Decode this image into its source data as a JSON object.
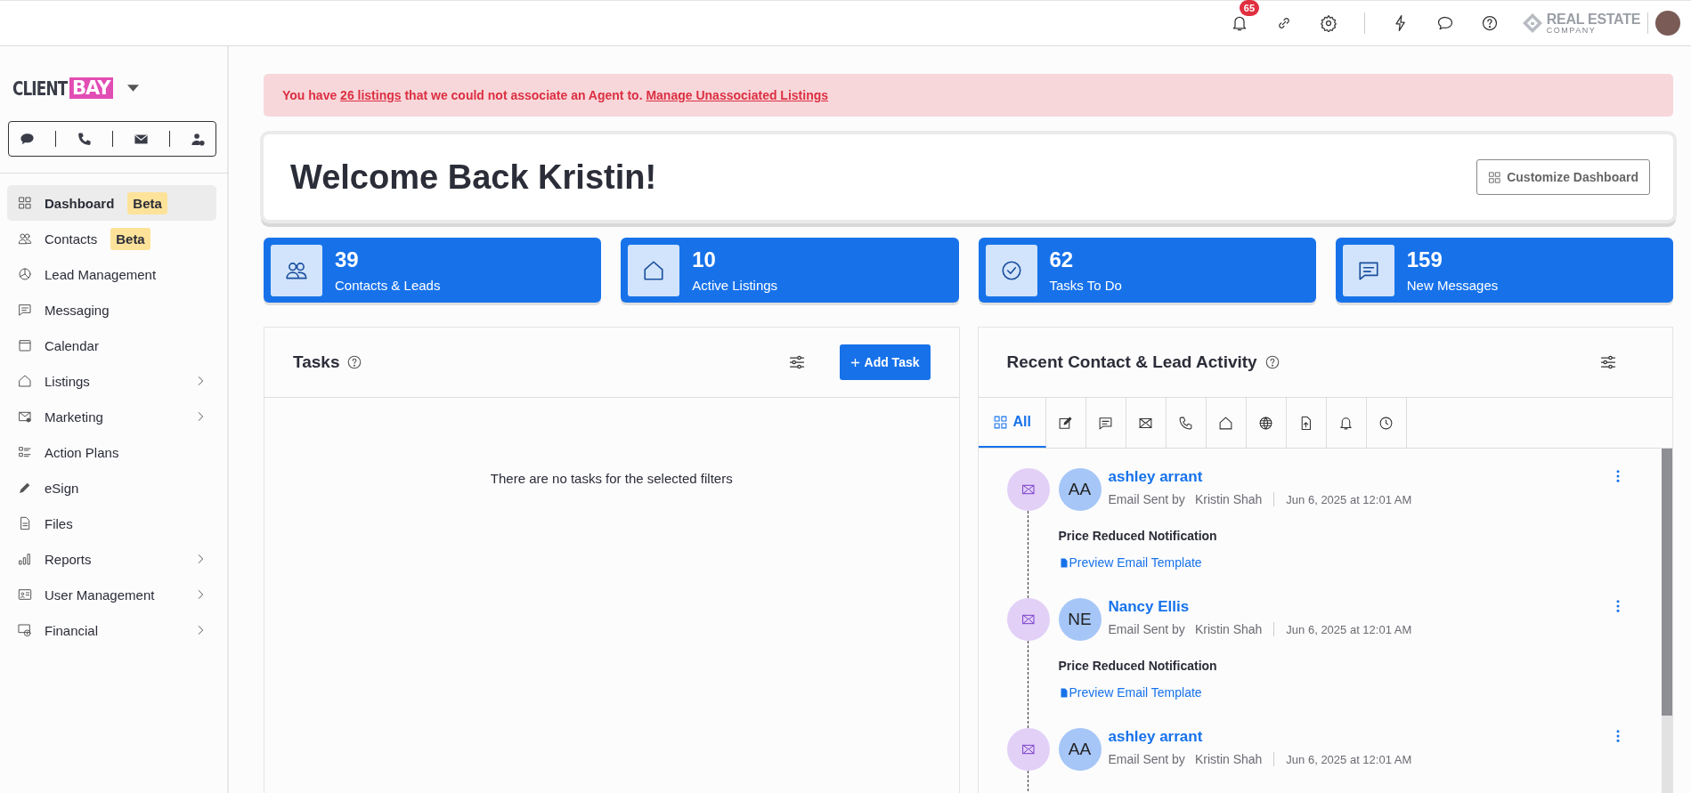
{
  "top_bar": {
    "notification_count": "65",
    "company_logo": {
      "name": "REAL ESTATE",
      "tagline": "COMPANY"
    }
  },
  "sidebar": {
    "brand": {
      "first": "CLIENT",
      "second": "BAY"
    },
    "items": [
      {
        "label": "Dashboard",
        "badge": "Beta",
        "selected": true,
        "expandable": false
      },
      {
        "label": "Contacts",
        "badge": "Beta",
        "selected": false,
        "expandable": false
      },
      {
        "label": "Lead Management",
        "selected": false,
        "expandable": false
      },
      {
        "label": "Messaging",
        "selected": false,
        "expandable": false
      },
      {
        "label": "Calendar",
        "selected": false,
        "expandable": false
      },
      {
        "label": "Listings",
        "selected": false,
        "expandable": true
      },
      {
        "label": "Marketing",
        "selected": false,
        "expandable": true
      },
      {
        "label": "Action Plans",
        "selected": false,
        "expandable": false
      },
      {
        "label": "eSign",
        "selected": false,
        "expandable": false
      },
      {
        "label": "Files",
        "selected": false,
        "expandable": false
      },
      {
        "label": "Reports",
        "selected": false,
        "expandable": true
      },
      {
        "label": "User Management",
        "selected": false,
        "expandable": true
      },
      {
        "label": "Financial",
        "selected": false,
        "expandable": true
      }
    ]
  },
  "alert": {
    "lead": "You have",
    "count_link": "26 listings",
    "middle": "that we could not associate an Agent to.",
    "action_link": "Manage Unassociated Listings"
  },
  "welcome": {
    "title": "Welcome Back Kristin!",
    "button": "Customize Dashboard"
  },
  "stats": [
    {
      "value": "39",
      "label": "Contacts & Leads"
    },
    {
      "value": "10",
      "label": "Active Listings"
    },
    {
      "value": "62",
      "label": "Tasks To Do"
    },
    {
      "value": "159",
      "label": "New Messages"
    }
  ],
  "tasks": {
    "title": "Tasks",
    "add_button": "Add Task",
    "empty_message": "There are no tasks for the selected filters"
  },
  "activity": {
    "title": "Recent Contact & Lead Activity",
    "tabs": [
      {
        "label": "All",
        "selected": true
      },
      {
        "selected": false
      },
      {
        "selected": false
      },
      {
        "selected": false
      },
      {
        "selected": false
      },
      {
        "selected": false
      },
      {
        "selected": false
      },
      {
        "selected": false
      },
      {
        "selected": false
      },
      {
        "selected": false
      }
    ],
    "items": [
      {
        "initials": "AA",
        "name": "ashley arrant",
        "action": "Email Sent by",
        "agent": "Kristin Shah",
        "date": "Jun 6, 2025 at 12:01 AM",
        "subject": "Price Reduced Notification",
        "link": "Preview Email Template"
      },
      {
        "initials": "NE",
        "name": "Nancy Ellis",
        "action": "Email Sent by",
        "agent": "Kristin Shah",
        "date": "Jun 6, 2025 at 12:01 AM",
        "subject": "Price Reduced Notification",
        "link": "Preview Email Template"
      },
      {
        "initials": "AA",
        "name": "ashley arrant",
        "action": "Email Sent by",
        "agent": "Kristin Shah",
        "date": "Jun 6, 2025 at 12:01 AM"
      }
    ]
  }
}
